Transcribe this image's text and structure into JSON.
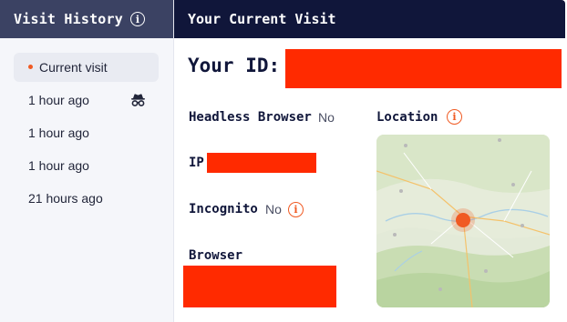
{
  "sidebar": {
    "title": "Visit History",
    "items": [
      {
        "label": "Current visit",
        "active": true,
        "incognito": false
      },
      {
        "label": "1 hour ago",
        "active": false,
        "incognito": true
      },
      {
        "label": "1 hour ago",
        "active": false,
        "incognito": false
      },
      {
        "label": "1 hour ago",
        "active": false,
        "incognito": false
      },
      {
        "label": "21 hours ago",
        "active": false,
        "incognito": false
      }
    ]
  },
  "main": {
    "title": "Your Current Visit",
    "your_id_label": "Your ID:",
    "headless_label": "Headless Browser",
    "headless_value": "No",
    "ip_label": "IP",
    "incognito_label": "Incognito",
    "incognito_value": "No",
    "browser_label": "Browser",
    "location_label": "Location"
  },
  "colors": {
    "sidebar_header": "#3b4263",
    "main_header": "#10163a",
    "accent": "#f05a23",
    "redaction": "#ff2a00"
  },
  "icons": {
    "info": "info-icon",
    "incognito": "spy-icon",
    "map_marker": "location-dot"
  }
}
